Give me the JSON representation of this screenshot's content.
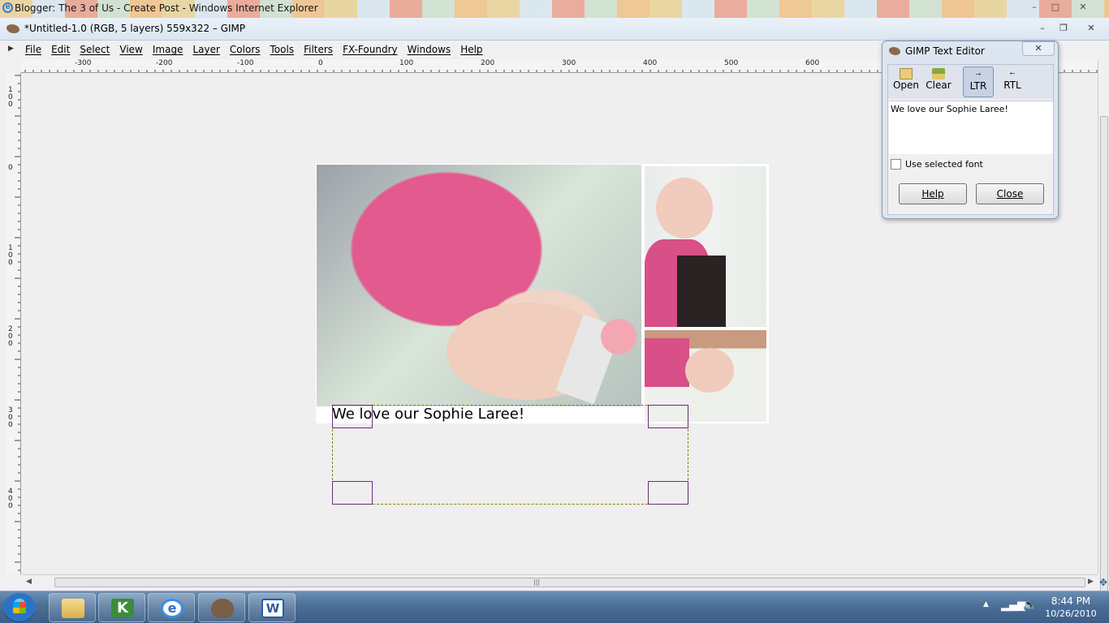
{
  "ie": {
    "title": "Blogger: The 3 of Us - Create Post - Windows Internet Explorer"
  },
  "gimp": {
    "title": "*Untitled-1.0 (RGB, 5 layers) 559x322 – GIMP",
    "menu": [
      "File",
      "Edit",
      "Select",
      "View",
      "Image",
      "Layer",
      "Colors",
      "Tools",
      "Filters",
      "FX-Foundry",
      "Windows",
      "Help"
    ]
  },
  "rulers": {
    "h_labels": [
      "-300",
      "-200",
      "-100",
      "0",
      "100",
      "200",
      "300",
      "400",
      "500",
      "600"
    ],
    "v_labels": [
      "1\n0\n0",
      "0",
      "1\n0\n0",
      "2\n0\n0",
      "3\n0\n0",
      "4\n0\n0"
    ]
  },
  "canvas": {
    "text": "We love our Sophie Laree!"
  },
  "text_editor": {
    "title": "GIMP Text Editor",
    "tools": {
      "open": "Open",
      "clear": "Clear",
      "ltr": "LTR",
      "rtl": "RTL"
    },
    "content": "We love our Sophie Laree!",
    "use_selected_font_label": "Use selected font",
    "use_selected_font_checked": false,
    "help_label": "Help",
    "close_label": "Close"
  },
  "taskbar": {
    "time": "8:44 PM",
    "date": "10/26/2010"
  }
}
